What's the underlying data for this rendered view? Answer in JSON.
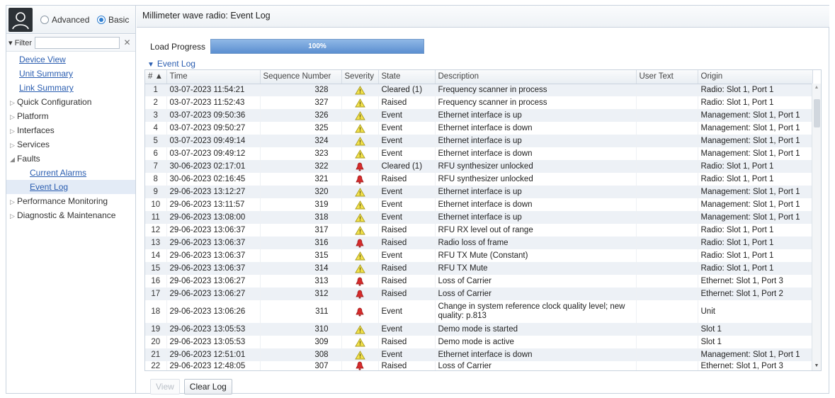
{
  "sidebar": {
    "mode_options": [
      {
        "label": "Advanced",
        "selected": false
      },
      {
        "label": "Basic",
        "selected": true
      }
    ],
    "filter_label": "Filter",
    "filter_value": "",
    "filter_clear": "✕",
    "tree": [
      {
        "label": "Device View",
        "type": "link",
        "level": 1
      },
      {
        "label": "Unit Summary",
        "type": "link",
        "level": 1
      },
      {
        "label": "Link Summary",
        "type": "link",
        "level": 1
      },
      {
        "label": "Quick Configuration",
        "type": "group",
        "arrow": "▷"
      },
      {
        "label": "Platform",
        "type": "group",
        "arrow": "▷"
      },
      {
        "label": "Interfaces",
        "type": "group",
        "arrow": "▷"
      },
      {
        "label": "Services",
        "type": "group",
        "arrow": "▷"
      },
      {
        "label": "Faults",
        "type": "group",
        "arrow": "◢"
      },
      {
        "label": "Current Alarms",
        "type": "link",
        "level": 2
      },
      {
        "label": "Event Log",
        "type": "link",
        "level": 2,
        "selected": true
      },
      {
        "label": "Performance Monitoring",
        "type": "group",
        "arrow": "▷"
      },
      {
        "label": "Diagnostic & Maintenance",
        "type": "group",
        "arrow": "▷"
      }
    ]
  },
  "main": {
    "title": "Millimeter wave radio: Event Log",
    "progress_label": "Load Progress",
    "progress_value": 100,
    "progress_text": "100%",
    "section_title": "Event Log",
    "columns": [
      "# ▲",
      "Time",
      "Sequence Number",
      "Severity",
      "State",
      "Description",
      "User Text",
      "Origin"
    ],
    "rows": [
      {
        "n": "1",
        "time": "03-07-2023 11:54:21",
        "seq": "328",
        "sev": "warning",
        "state": "Cleared (1)",
        "desc": "Frequency scanner in process",
        "user": "",
        "origin": "Radio: Slot 1, Port 1"
      },
      {
        "n": "2",
        "time": "03-07-2023 11:52:43",
        "seq": "327",
        "sev": "warning",
        "state": "Raised",
        "desc": "Frequency scanner in process",
        "user": "",
        "origin": "Radio: Slot 1, Port 1"
      },
      {
        "n": "3",
        "time": "03-07-2023 09:50:36",
        "seq": "326",
        "sev": "warning",
        "state": "Event",
        "desc": "Ethernet interface is up",
        "user": "",
        "origin": "Management: Slot 1, Port 1"
      },
      {
        "n": "4",
        "time": "03-07-2023 09:50:27",
        "seq": "325",
        "sev": "warning",
        "state": "Event",
        "desc": "Ethernet interface is down",
        "user": "",
        "origin": "Management: Slot 1, Port 1"
      },
      {
        "n": "5",
        "time": "03-07-2023 09:49:14",
        "seq": "324",
        "sev": "warning",
        "state": "Event",
        "desc": "Ethernet interface is up",
        "user": "",
        "origin": "Management: Slot 1, Port 1"
      },
      {
        "n": "6",
        "time": "03-07-2023 09:49:12",
        "seq": "323",
        "sev": "warning",
        "state": "Event",
        "desc": "Ethernet interface is down",
        "user": "",
        "origin": "Management: Slot 1, Port 1"
      },
      {
        "n": "7",
        "time": "30-06-2023 02:17:01",
        "seq": "322",
        "sev": "critical",
        "state": "Cleared (1)",
        "desc": "RFU synthesizer unlocked",
        "user": "",
        "origin": "Radio: Slot 1, Port 1"
      },
      {
        "n": "8",
        "time": "30-06-2023 02:16:45",
        "seq": "321",
        "sev": "critical",
        "state": "Raised",
        "desc": "RFU synthesizer unlocked",
        "user": "",
        "origin": "Radio: Slot 1, Port 1"
      },
      {
        "n": "9",
        "time": "29-06-2023 13:12:27",
        "seq": "320",
        "sev": "warning",
        "state": "Event",
        "desc": "Ethernet interface is up",
        "user": "",
        "origin": "Management: Slot 1, Port 1"
      },
      {
        "n": "10",
        "time": "29-06-2023 13:11:57",
        "seq": "319",
        "sev": "warning",
        "state": "Event",
        "desc": "Ethernet interface is down",
        "user": "",
        "origin": "Management: Slot 1, Port 1"
      },
      {
        "n": "11",
        "time": "29-06-2023 13:08:00",
        "seq": "318",
        "sev": "warning",
        "state": "Event",
        "desc": "Ethernet interface is up",
        "user": "",
        "origin": "Management: Slot 1, Port 1"
      },
      {
        "n": "12",
        "time": "29-06-2023 13:06:37",
        "seq": "317",
        "sev": "warning",
        "state": "Raised",
        "desc": "RFU RX level out of range",
        "user": "",
        "origin": "Radio: Slot 1, Port 1"
      },
      {
        "n": "13",
        "time": "29-06-2023 13:06:37",
        "seq": "316",
        "sev": "critical",
        "state": "Raised",
        "desc": "Radio loss of frame",
        "user": "",
        "origin": "Radio: Slot 1, Port 1"
      },
      {
        "n": "14",
        "time": "29-06-2023 13:06:37",
        "seq": "315",
        "sev": "warning",
        "state": "Event",
        "desc": "RFU TX Mute (Constant)",
        "user": "",
        "origin": "Radio: Slot 1, Port 1"
      },
      {
        "n": "15",
        "time": "29-06-2023 13:06:37",
        "seq": "314",
        "sev": "warning",
        "state": "Raised",
        "desc": "RFU TX Mute",
        "user": "",
        "origin": "Radio: Slot 1, Port 1"
      },
      {
        "n": "16",
        "time": "29-06-2023 13:06:27",
        "seq": "313",
        "sev": "critical",
        "state": "Raised",
        "desc": "Loss of Carrier",
        "user": "",
        "origin": "Ethernet: Slot 1, Port 3"
      },
      {
        "n": "17",
        "time": "29-06-2023 13:06:27",
        "seq": "312",
        "sev": "critical",
        "state": "Raised",
        "desc": "Loss of Carrier",
        "user": "",
        "origin": "Ethernet: Slot 1, Port 2"
      },
      {
        "n": "18",
        "time": "29-06-2023 13:06:26",
        "seq": "311",
        "sev": "critical",
        "state": "Event",
        "desc": "Change in system reference clock quality level; new quality: p.813",
        "user": "",
        "origin": "Unit",
        "tall": true
      },
      {
        "n": "19",
        "time": "29-06-2023 13:05:53",
        "seq": "310",
        "sev": "warning",
        "state": "Event",
        "desc": "Demo mode is started",
        "user": "",
        "origin": "Slot 1"
      },
      {
        "n": "20",
        "time": "29-06-2023 13:05:53",
        "seq": "309",
        "sev": "warning",
        "state": "Raised",
        "desc": "Demo mode is active",
        "user": "",
        "origin": "Slot 1"
      },
      {
        "n": "21",
        "time": "29-06-2023 12:51:01",
        "seq": "308",
        "sev": "warning",
        "state": "Event",
        "desc": "Ethernet interface is down",
        "user": "",
        "origin": "Management: Slot 1, Port 1"
      },
      {
        "n": "22",
        "time": "29-06-2023 12:48:05",
        "seq": "307",
        "sev": "critical",
        "state": "Raised",
        "desc": "Loss of Carrier",
        "user": "",
        "origin": "Ethernet: Slot 1, Port 3",
        "cut": true
      }
    ],
    "buttons": {
      "view": "View",
      "clear": "Clear Log"
    }
  },
  "colors": {
    "warning": "#f3e24a",
    "critical": "#d62b2b",
    "accent": "#5b8fd0"
  }
}
